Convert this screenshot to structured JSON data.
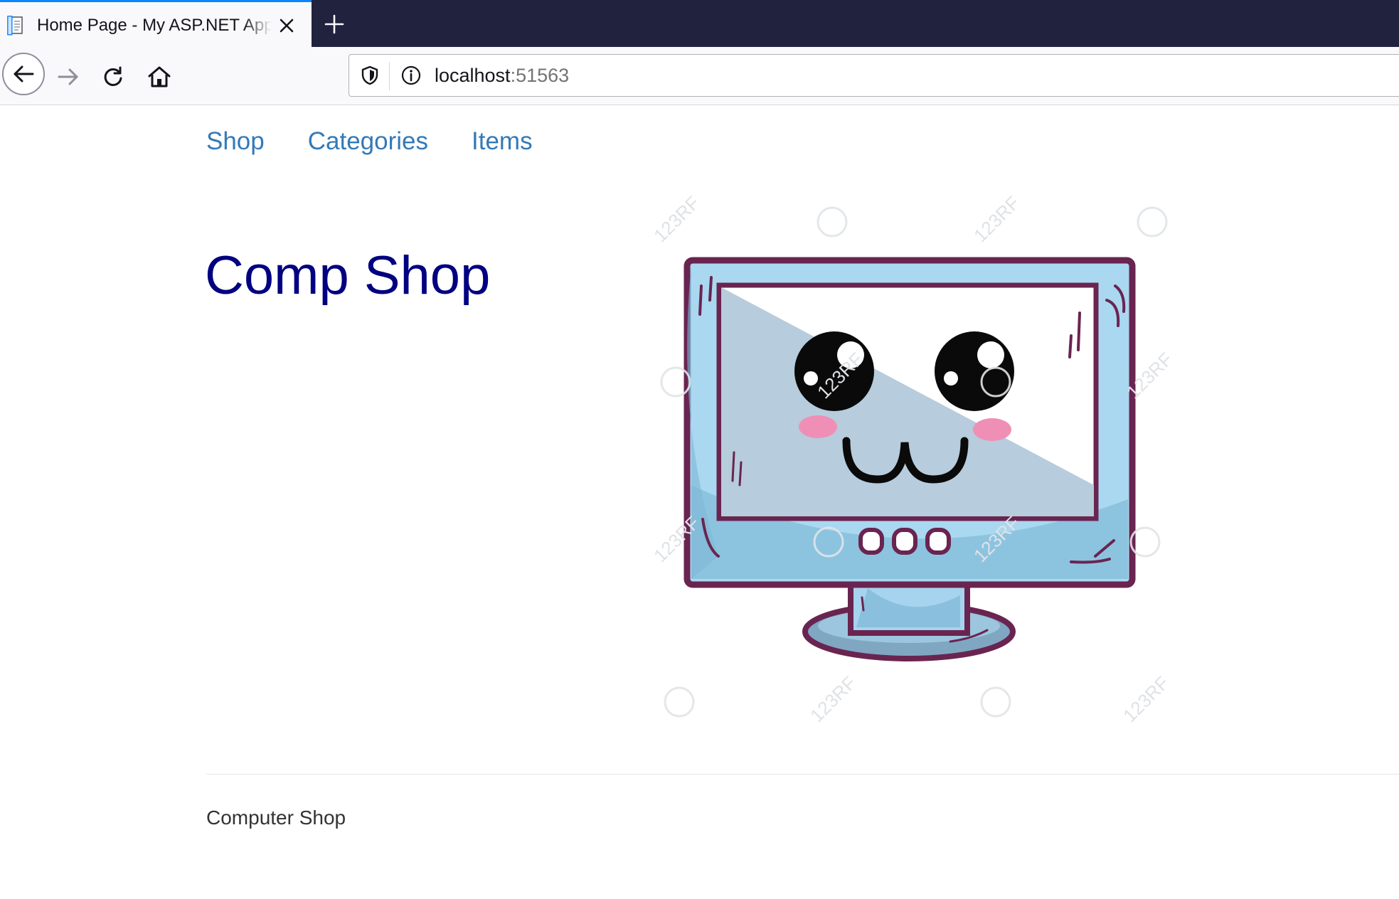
{
  "browser": {
    "tab_title": "Home Page - My ASP.NET Application",
    "url_host": "localhost",
    "url_port": ":51563",
    "colors": {
      "tabbar": "#20223e",
      "active_tab_accent": "#0a84ff"
    }
  },
  "site_nav": {
    "items": [
      {
        "label": "Shop"
      },
      {
        "label": "Categories"
      },
      {
        "label": "Items"
      }
    ],
    "link_color": "#337ab7"
  },
  "main": {
    "title": "Comp Shop",
    "title_color": "#000080",
    "hero_watermark": "123RF"
  },
  "footer": {
    "text": "Computer Shop"
  }
}
